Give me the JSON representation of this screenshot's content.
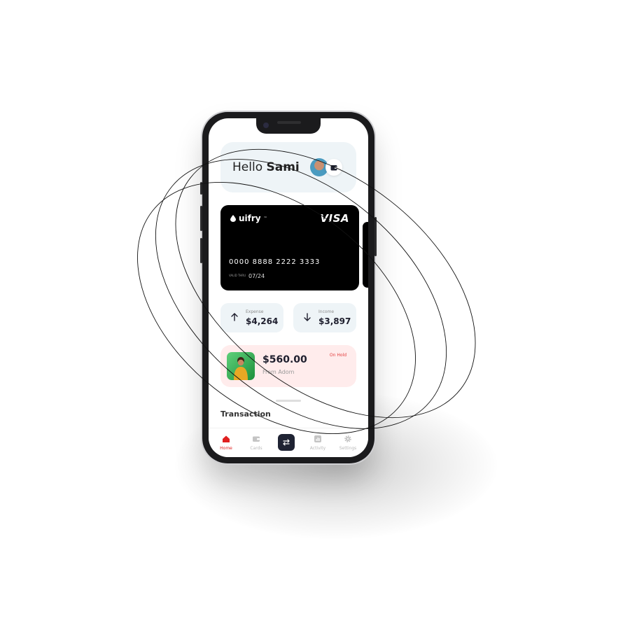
{
  "header": {
    "greeting": "Hello",
    "user_name": "Sami"
  },
  "card": {
    "brand": "uifry",
    "brand_mark": "™",
    "network": "VISA",
    "number": "0000 8888 2222 3333",
    "valid_label": "VALID THRU",
    "expiry": "07/24"
  },
  "stats": [
    {
      "label": "Expense",
      "value": "$4,264",
      "direction": "up"
    },
    {
      "label": "Income",
      "value": "$3,897",
      "direction": "down"
    }
  ],
  "pending": {
    "amount": "$560.00",
    "from": "From Adom",
    "status": "On Hold"
  },
  "transactions": {
    "title": "Transaction"
  },
  "tabs": [
    {
      "label": "Home",
      "icon": "home-icon",
      "active": true
    },
    {
      "label": "Cards",
      "icon": "wallet-icon",
      "active": false
    },
    {
      "label": "",
      "icon": "swap-icon",
      "active": false
    },
    {
      "label": "Activity",
      "icon": "chart-icon",
      "active": false
    },
    {
      "label": "Settings",
      "icon": "gear-icon",
      "active": false
    }
  ],
  "colors": {
    "accent": "#e02020",
    "card": "#000000",
    "panel": "#eef4f7",
    "pending_bg": "#ffecec",
    "dark_button": "#1f2333"
  }
}
